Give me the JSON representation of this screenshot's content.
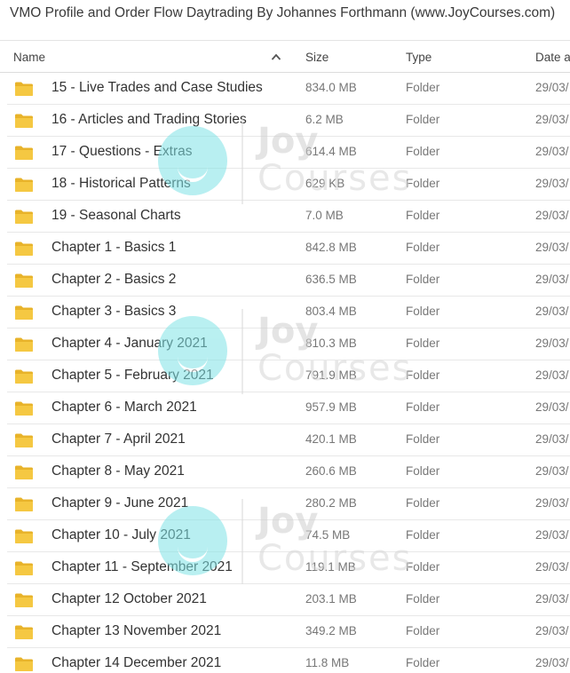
{
  "title": "VMO Profile and Order Flow Daytrading By Johannes Forthmann (www.JoyCourses.com)",
  "columns": {
    "name": "Name",
    "size": "Size",
    "type": "Type",
    "date": "Date a"
  },
  "sort": {
    "column": "Name",
    "direction": "ascending",
    "icon": "chevron-up-icon"
  },
  "rows": [
    {
      "name": "15 - Live Trades and Case Studies",
      "size": "834.0 MB",
      "type": "Folder",
      "date": "29/03/"
    },
    {
      "name": "16 - Articles and Trading Stories",
      "size": "6.2 MB",
      "type": "Folder",
      "date": "29/03/"
    },
    {
      "name": "17 - Questions - Extras",
      "size": "614.4 MB",
      "type": "Folder",
      "date": "29/03/"
    },
    {
      "name": "18 - Historical Patterns",
      "size": "629 KB",
      "type": "Folder",
      "date": "29/03/"
    },
    {
      "name": "19 - Seasonal Charts",
      "size": "7.0 MB",
      "type": "Folder",
      "date": "29/03/"
    },
    {
      "name": "Chapter 1 - Basics 1",
      "size": "842.8 MB",
      "type": "Folder",
      "date": "29/03/"
    },
    {
      "name": "Chapter 2 - Basics 2",
      "size": "636.5 MB",
      "type": "Folder",
      "date": "29/03/"
    },
    {
      "name": "Chapter 3 - Basics 3",
      "size": "803.4 MB",
      "type": "Folder",
      "date": "29/03/"
    },
    {
      "name": "Chapter 4 - January 2021",
      "size": "810.3 MB",
      "type": "Folder",
      "date": "29/03/"
    },
    {
      "name": "Chapter 5 - February 2021",
      "size": "791.9 MB",
      "type": "Folder",
      "date": "29/03/"
    },
    {
      "name": "Chapter 6 - March 2021",
      "size": "957.9 MB",
      "type": "Folder",
      "date": "29/03/"
    },
    {
      "name": "Chapter 7 - April 2021",
      "size": "420.1 MB",
      "type": "Folder",
      "date": "29/03/"
    },
    {
      "name": "Chapter 8 - May 2021",
      "size": "260.6 MB",
      "type": "Folder",
      "date": "29/03/"
    },
    {
      "name": "Chapter 9 - June 2021",
      "size": "280.2 MB",
      "type": "Folder",
      "date": "29/03/"
    },
    {
      "name": "Chapter 10 - July 2021",
      "size": "74.5 MB",
      "type": "Folder",
      "date": "29/03/"
    },
    {
      "name": "Chapter 11 - September 2021",
      "size": "119.1 MB",
      "type": "Folder",
      "date": "29/03/"
    },
    {
      "name": "Chapter 12 October 2021",
      "size": "203.1 MB",
      "type": "Folder",
      "date": "29/03/"
    },
    {
      "name": "Chapter 13 November 2021",
      "size": "349.2 MB",
      "type": "Folder",
      "date": "29/03/"
    },
    {
      "name": "Chapter 14 December 2021",
      "size": "11.8 MB",
      "type": "Folder",
      "date": "29/03/"
    }
  ],
  "watermark": {
    "line1": "Joy",
    "line2": "Courses",
    "icon": "joycourses-logo-icon"
  },
  "colors": {
    "folder": "#f5c842",
    "folder_dark": "#e8b32a",
    "watermark": "#7fe3e6"
  }
}
